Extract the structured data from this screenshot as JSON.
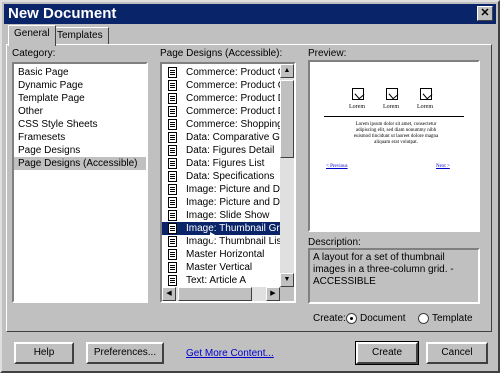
{
  "window": {
    "title": "New Document"
  },
  "tabs": [
    {
      "label": "General"
    },
    {
      "label": "Templates"
    }
  ],
  "category": {
    "label": "Category:",
    "items": [
      "Basic Page",
      "Dynamic Page",
      "Template Page",
      "Other",
      "CSS Style Sheets",
      "Framesets",
      "Page Designs",
      "Page Designs (Accessible)"
    ],
    "selected": "Page Designs (Accessible)"
  },
  "designs": {
    "label": "Page Designs (Accessible):",
    "items": [
      "Commerce: Product Ca",
      "Commerce: Product Ca",
      "Commerce: Product De",
      "Commerce: Product De",
      "Commerce: Shopping C",
      "Data: Comparative Gric",
      "Data: Figures Detail",
      "Data: Figures List",
      "Data: Specifications",
      "Image: Picture and Des",
      "Image: Picture and Des",
      "Image: Slide Show",
      "Image: Thumbnail Grid",
      "Image: Thumbnail List",
      "Master Horizontal",
      "Master Vertical",
      "Text: Article A"
    ],
    "selected": "Image: Thumbnail Grid"
  },
  "preview": {
    "label": "Preview:",
    "captions": [
      "Lorem",
      "Lorem",
      "Lorem"
    ],
    "paragraph": "Lorem ipsum dolor sit amet, consectetur adipiscing elit, sed diam nonummy nibh euismod tincidunt ut laoreet dolore magna aliquam erat volutpat.",
    "link_left": "< Previous",
    "link_right": "Next >"
  },
  "description": {
    "label": "Description:",
    "text": "A layout for a set of thumbnail images in a three-column grid. - ACCESSIBLE"
  },
  "create": {
    "label": "Create:",
    "options": [
      {
        "label": "Document",
        "checked": true
      },
      {
        "label": "Template",
        "checked": false
      }
    ]
  },
  "buttons": {
    "help": "Help",
    "preferences": "Preferences...",
    "get_more": "Get More Content...",
    "create": "Create",
    "cancel": "Cancel"
  },
  "icons": {
    "close": "close-icon",
    "scroll_up": "arrow-up-icon",
    "scroll_down": "arrow-down-icon",
    "scroll_left": "arrow-left-icon",
    "scroll_right": "arrow-right-icon",
    "document": "document-icon"
  },
  "colors": {
    "title_bar": "#0a246a",
    "dialog": "#c0c0c0",
    "selection": "#0a246a",
    "link": "#0000cc"
  }
}
